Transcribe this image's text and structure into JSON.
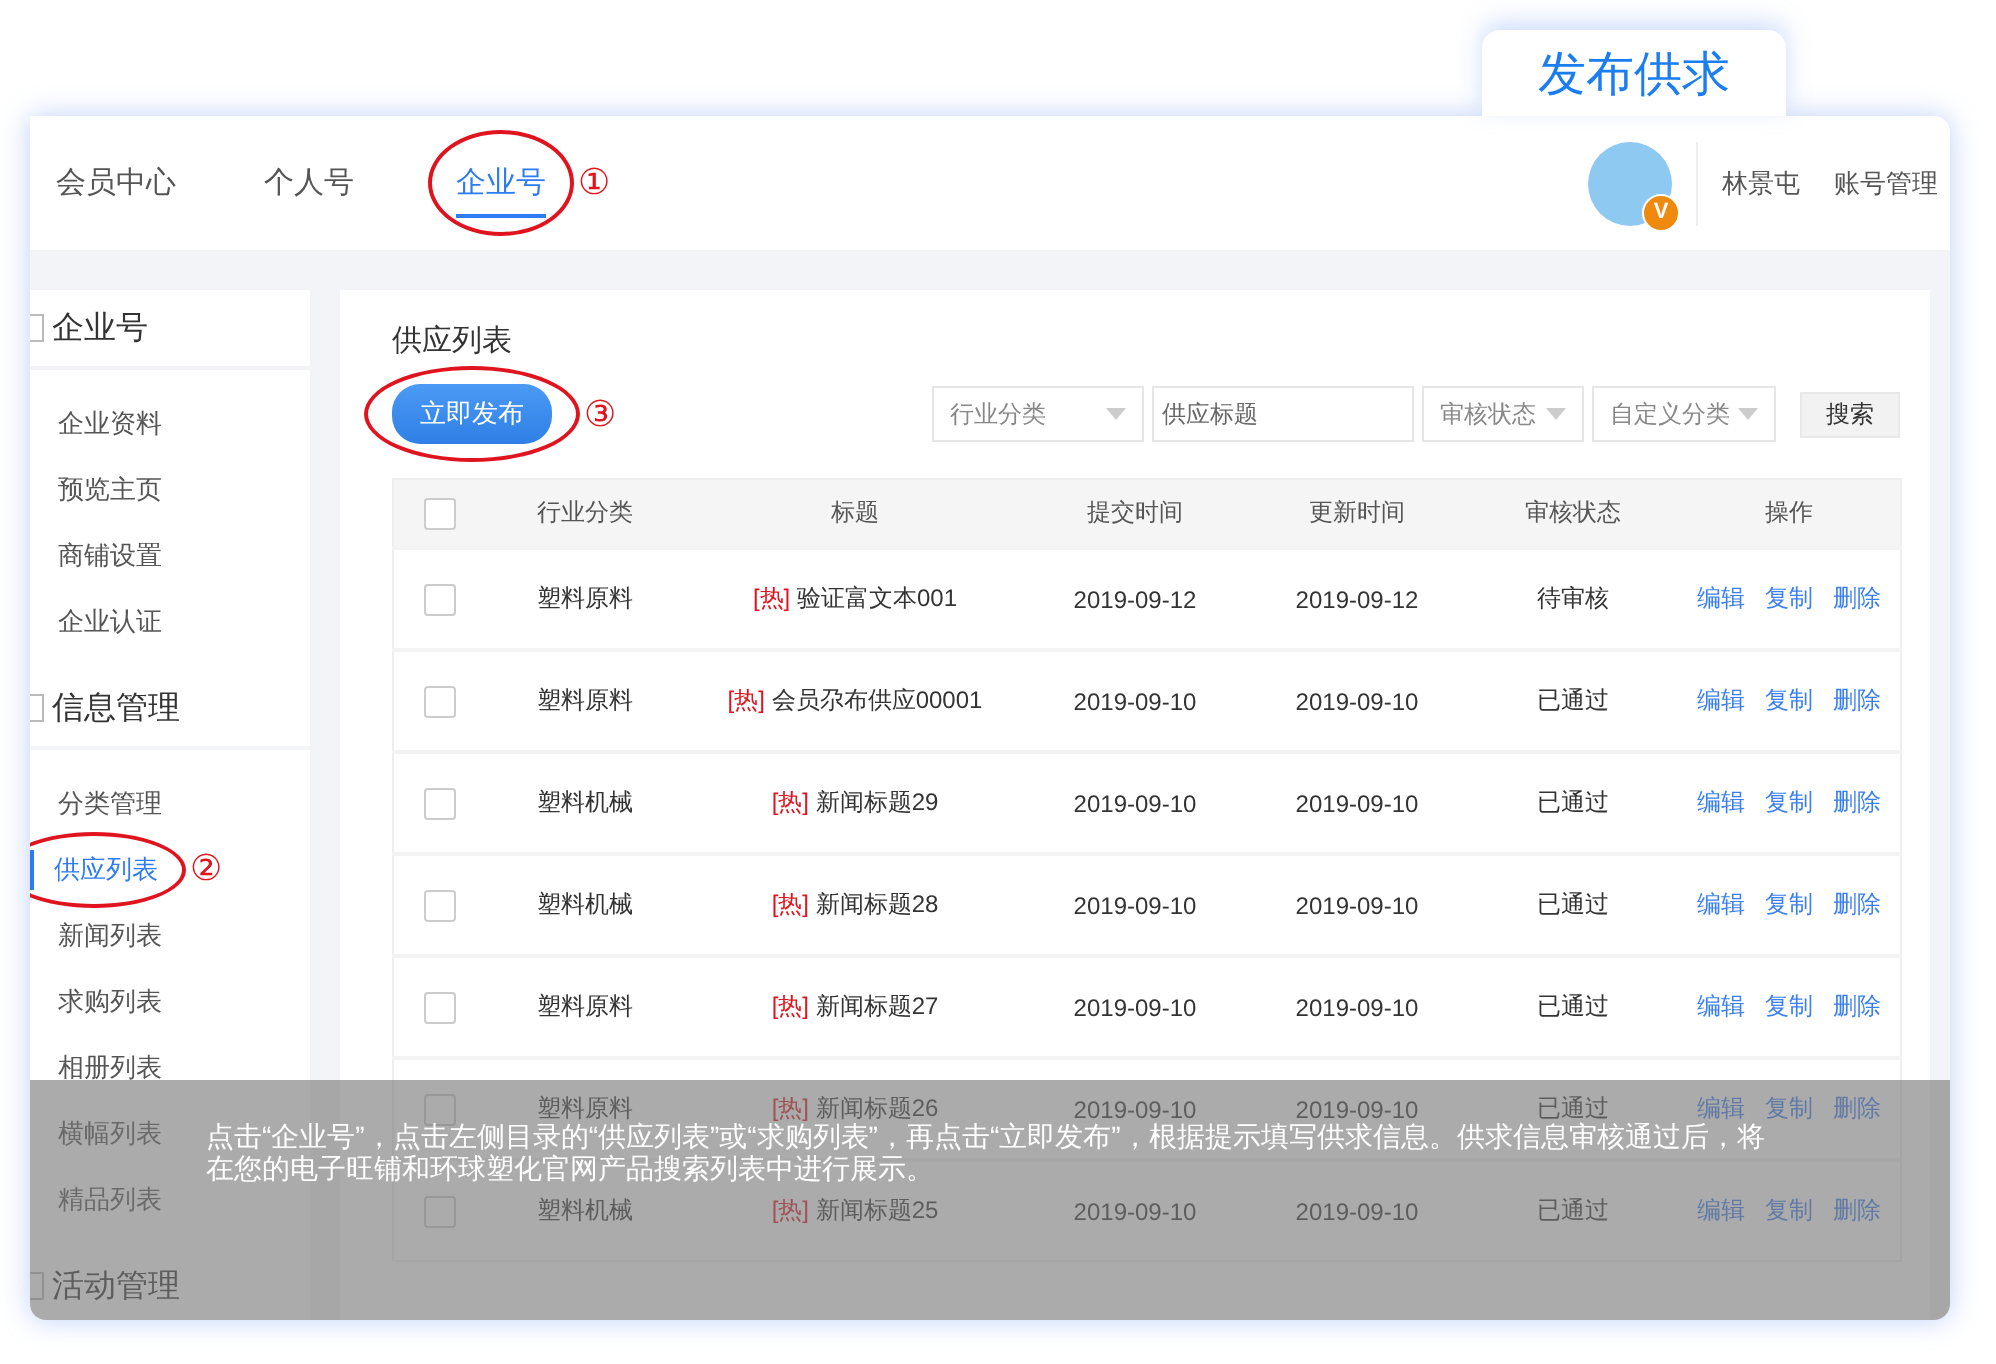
{
  "publish_tab": {
    "label": "发布供求"
  },
  "nav": {
    "tabs": [
      {
        "label": "会员中心",
        "selected": false
      },
      {
        "label": "个人号",
        "selected": false
      },
      {
        "label": "企业号",
        "selected": true,
        "step": "①"
      }
    ],
    "avatar_badge": "V",
    "user": "林景屯",
    "account_link": "账号管理"
  },
  "sidebar": {
    "groups": [
      {
        "title": "企业号",
        "items": [
          {
            "label": "企业资料",
            "selected": false
          },
          {
            "label": "预览主页",
            "selected": false
          },
          {
            "label": "商铺设置",
            "selected": false
          },
          {
            "label": "企业认证",
            "selected": false
          }
        ]
      },
      {
        "title": "信息管理",
        "items": [
          {
            "label": "分类管理",
            "selected": false
          },
          {
            "label": "供应列表",
            "selected": true,
            "step": "②"
          },
          {
            "label": "新闻列表",
            "selected": false
          },
          {
            "label": "求购列表",
            "selected": false
          },
          {
            "label": "相册列表",
            "selected": false
          },
          {
            "label": "横幅列表",
            "selected": false
          },
          {
            "label": "精品列表",
            "selected": false
          }
        ]
      },
      {
        "title": "活动管理"
      }
    ]
  },
  "main": {
    "title": "供应列表",
    "publish_button": {
      "label": "立即发布",
      "step": "③"
    },
    "filters": [
      {
        "kind": "select",
        "placeholder": "行业分类"
      },
      {
        "kind": "input",
        "placeholder": "供应标题"
      },
      {
        "kind": "select",
        "placeholder": "审核状态"
      },
      {
        "kind": "select",
        "placeholder": "自定义分类"
      }
    ],
    "search_button": "搜索",
    "table": {
      "select_all": false,
      "columns": [
        "行业分类",
        "标题",
        "提交时间",
        "更新时间",
        "审核状态",
        "操作"
      ],
      "rows": [
        {
          "checked": false,
          "category": "塑料原料",
          "tag": "[热]",
          "title": "验证富文本001",
          "submitted": "2019-09-12",
          "updated": "2019-09-12",
          "status": "待审核",
          "actions": [
            "编辑",
            "复制",
            "删除"
          ]
        },
        {
          "checked": false,
          "category": "塑料原料",
          "tag": "[热]",
          "title": "会员尕布供应00001",
          "submitted": "2019-09-10",
          "updated": "2019-09-10",
          "status": "已通过",
          "actions": [
            "编辑",
            "复制",
            "删除"
          ]
        },
        {
          "checked": false,
          "category": "塑料机械",
          "tag": "[热]",
          "title": "新闻标题29",
          "submitted": "2019-09-10",
          "updated": "2019-09-10",
          "status": "已通过",
          "actions": [
            "编辑",
            "复制",
            "删除"
          ]
        },
        {
          "checked": false,
          "category": "塑料机械",
          "tag": "[热]",
          "title": "新闻标题28",
          "submitted": "2019-09-10",
          "updated": "2019-09-10",
          "status": "已通过",
          "actions": [
            "编辑",
            "复制",
            "删除"
          ]
        },
        {
          "checked": false,
          "category": "塑料原料",
          "tag": "[热]",
          "title": "新闻标题27",
          "submitted": "2019-09-10",
          "updated": "2019-09-10",
          "status": "已通过",
          "actions": [
            "编辑",
            "复制",
            "删除"
          ]
        },
        {
          "checked": false,
          "category": "塑料原料",
          "tag": "[热]",
          "title": "新闻标题26",
          "submitted": "2019-09-10",
          "updated": "2019-09-10",
          "status": "已通过",
          "actions": [
            "编辑",
            "复制",
            "删除"
          ]
        },
        {
          "checked": false,
          "category": "塑料机械",
          "tag": "[热]",
          "title": "新闻标题25",
          "submitted": "2019-09-10",
          "updated": "2019-09-10",
          "status": "已通过",
          "actions": [
            "编辑",
            "复制",
            "删除"
          ]
        }
      ]
    }
  },
  "caption": "点击“企业号”，点击左侧目录的“供应列表”或“求购列表”，再点击“立即发布”，根据提示填写供求信息。供求信息审核通过后，将在您的电子旺铺和环球塑化官网产品搜索列表中进行展示。"
}
